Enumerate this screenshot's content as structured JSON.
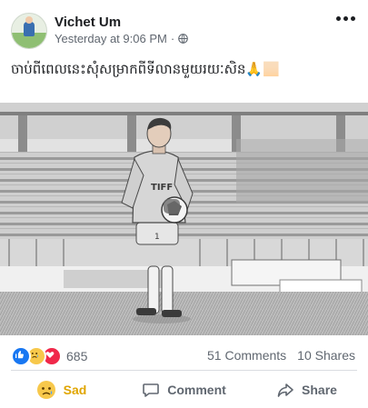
{
  "post": {
    "author": "Vichet Um",
    "time": "Yesterday at 9:06 PM",
    "audience_icon": "globe-icon",
    "text": "ចាប់ពីពេលនេះសុំសម្រាកពីទីលានមួយរយៈសិន🙏🏻"
  },
  "photo": {
    "description_icon": "photo-goalkeeper",
    "jersey_number": "1"
  },
  "reactions": {
    "icons": [
      "like-icon",
      "sad-icon",
      "love-icon"
    ],
    "count": "685",
    "comments": "51 Comments",
    "shares": "10 Shares"
  },
  "actions": {
    "reaction_label": "Sad",
    "comment_label": "Comment",
    "share_label": "Share"
  },
  "colors": {
    "like": "#1877f2",
    "love": "#f0284a",
    "sad": "#f7c84b",
    "active_reaction": "#e0a500",
    "secondary_text": "#606770"
  }
}
